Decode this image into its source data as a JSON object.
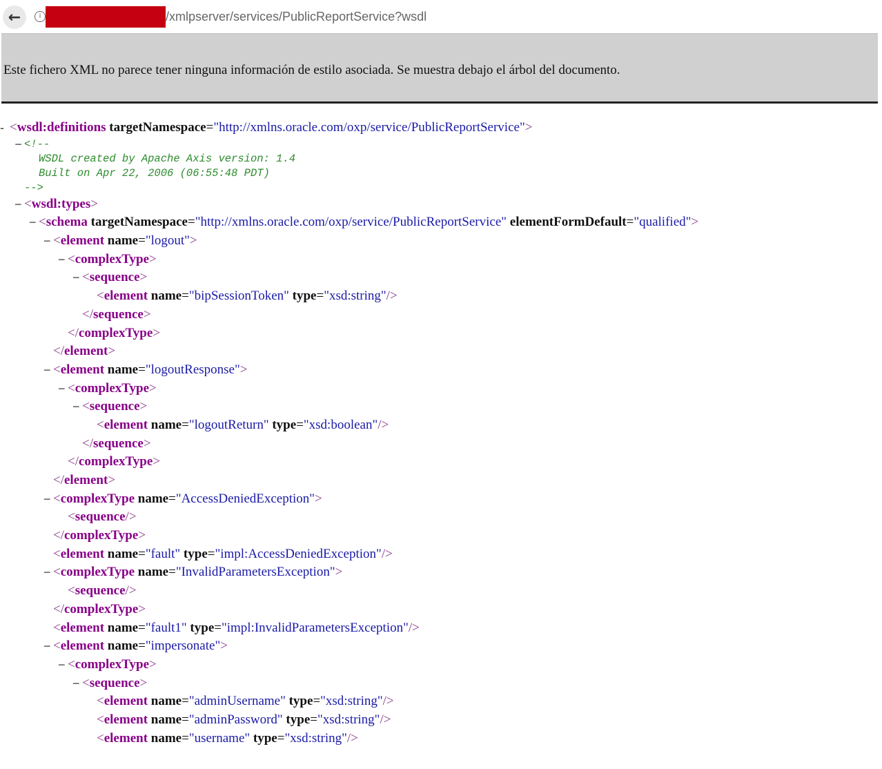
{
  "browser": {
    "url": "/xmlpserver/services/PublicReportService?wsdl"
  },
  "banner": {
    "text": "Este fichero XML no parece tener ninguna información de estilo asociada. Se muestra debajo el árbol del documento."
  },
  "xml": {
    "lines": [
      {
        "type": "open",
        "indent": 0,
        "toggle": "-",
        "tag": "wsdl:definitions",
        "attrs": [
          [
            "targetNamespace",
            "http://xmlns.oracle.com/oxp/service/PublicReportService"
          ]
        ]
      },
      {
        "type": "comment-start",
        "indent": 1,
        "toggle": "−",
        "text": "<!--"
      },
      {
        "type": "comment",
        "indent": 2,
        "text": "WSDL created by Apache Axis version: 1.4"
      },
      {
        "type": "comment",
        "indent": 2,
        "text": "Built on Apr 22, 2006 (06:55:48 PDT)"
      },
      {
        "type": "comment-end",
        "indent": 1,
        "text": "-->"
      },
      {
        "type": "open",
        "indent": 1,
        "toggle": "−",
        "tag": "wsdl:types",
        "attrs": []
      },
      {
        "type": "open",
        "indent": 2,
        "toggle": "−",
        "tag": "schema",
        "attrs": [
          [
            "targetNamespace",
            "http://xmlns.oracle.com/oxp/service/PublicReportService"
          ],
          [
            "elementFormDefault",
            "qualified"
          ]
        ]
      },
      {
        "type": "open",
        "indent": 3,
        "toggle": "−",
        "tag": "element",
        "attrs": [
          [
            "name",
            "logout"
          ]
        ]
      },
      {
        "type": "open",
        "indent": 4,
        "toggle": "−",
        "tag": "complexType",
        "attrs": []
      },
      {
        "type": "open",
        "indent": 5,
        "toggle": "−",
        "tag": "sequence",
        "attrs": []
      },
      {
        "type": "self",
        "indent": 6,
        "tag": "element",
        "attrs": [
          [
            "name",
            "bipSessionToken"
          ],
          [
            "type",
            "xsd:string"
          ]
        ]
      },
      {
        "type": "close",
        "indent": 5,
        "tag": "sequence"
      },
      {
        "type": "close",
        "indent": 4,
        "tag": "complexType"
      },
      {
        "type": "close",
        "indent": 3,
        "tag": "element"
      },
      {
        "type": "open",
        "indent": 3,
        "toggle": "−",
        "tag": "element",
        "attrs": [
          [
            "name",
            "logoutResponse"
          ]
        ]
      },
      {
        "type": "open",
        "indent": 4,
        "toggle": "−",
        "tag": "complexType",
        "attrs": []
      },
      {
        "type": "open",
        "indent": 5,
        "toggle": "−",
        "tag": "sequence",
        "attrs": []
      },
      {
        "type": "self",
        "indent": 6,
        "tag": "element",
        "attrs": [
          [
            "name",
            "logoutReturn"
          ],
          [
            "type",
            "xsd:boolean"
          ]
        ]
      },
      {
        "type": "close",
        "indent": 5,
        "tag": "sequence"
      },
      {
        "type": "close",
        "indent": 4,
        "tag": "complexType"
      },
      {
        "type": "close",
        "indent": 3,
        "tag": "element"
      },
      {
        "type": "open",
        "indent": 3,
        "toggle": "−",
        "tag": "complexType",
        "attrs": [
          [
            "name",
            "AccessDeniedException"
          ]
        ]
      },
      {
        "type": "self",
        "indent": 4,
        "tag": "sequence",
        "attrs": []
      },
      {
        "type": "close",
        "indent": 3,
        "tag": "complexType"
      },
      {
        "type": "self",
        "indent": 3,
        "tag": "element",
        "attrs": [
          [
            "name",
            "fault"
          ],
          [
            "type",
            "impl:AccessDeniedException"
          ]
        ]
      },
      {
        "type": "open",
        "indent": 3,
        "toggle": "−",
        "tag": "complexType",
        "attrs": [
          [
            "name",
            "InvalidParametersException"
          ]
        ]
      },
      {
        "type": "self",
        "indent": 4,
        "tag": "sequence",
        "attrs": []
      },
      {
        "type": "close",
        "indent": 3,
        "tag": "complexType"
      },
      {
        "type": "self",
        "indent": 3,
        "tag": "element",
        "attrs": [
          [
            "name",
            "fault1"
          ],
          [
            "type",
            "impl:InvalidParametersException"
          ]
        ]
      },
      {
        "type": "open",
        "indent": 3,
        "toggle": "−",
        "tag": "element",
        "attrs": [
          [
            "name",
            "impersonate"
          ]
        ]
      },
      {
        "type": "open",
        "indent": 4,
        "toggle": "−",
        "tag": "complexType",
        "attrs": []
      },
      {
        "type": "open",
        "indent": 5,
        "toggle": "−",
        "tag": "sequence",
        "attrs": []
      },
      {
        "type": "self",
        "indent": 6,
        "tag": "element",
        "attrs": [
          [
            "name",
            "adminUsername"
          ],
          [
            "type",
            "xsd:string"
          ]
        ]
      },
      {
        "type": "self",
        "indent": 6,
        "tag": "element",
        "attrs": [
          [
            "name",
            "adminPassword"
          ],
          [
            "type",
            "xsd:string"
          ]
        ]
      },
      {
        "type": "self",
        "indent": 6,
        "tag": "element",
        "attrs": [
          [
            "name",
            "username"
          ],
          [
            "type",
            "xsd:string"
          ]
        ]
      }
    ]
  }
}
